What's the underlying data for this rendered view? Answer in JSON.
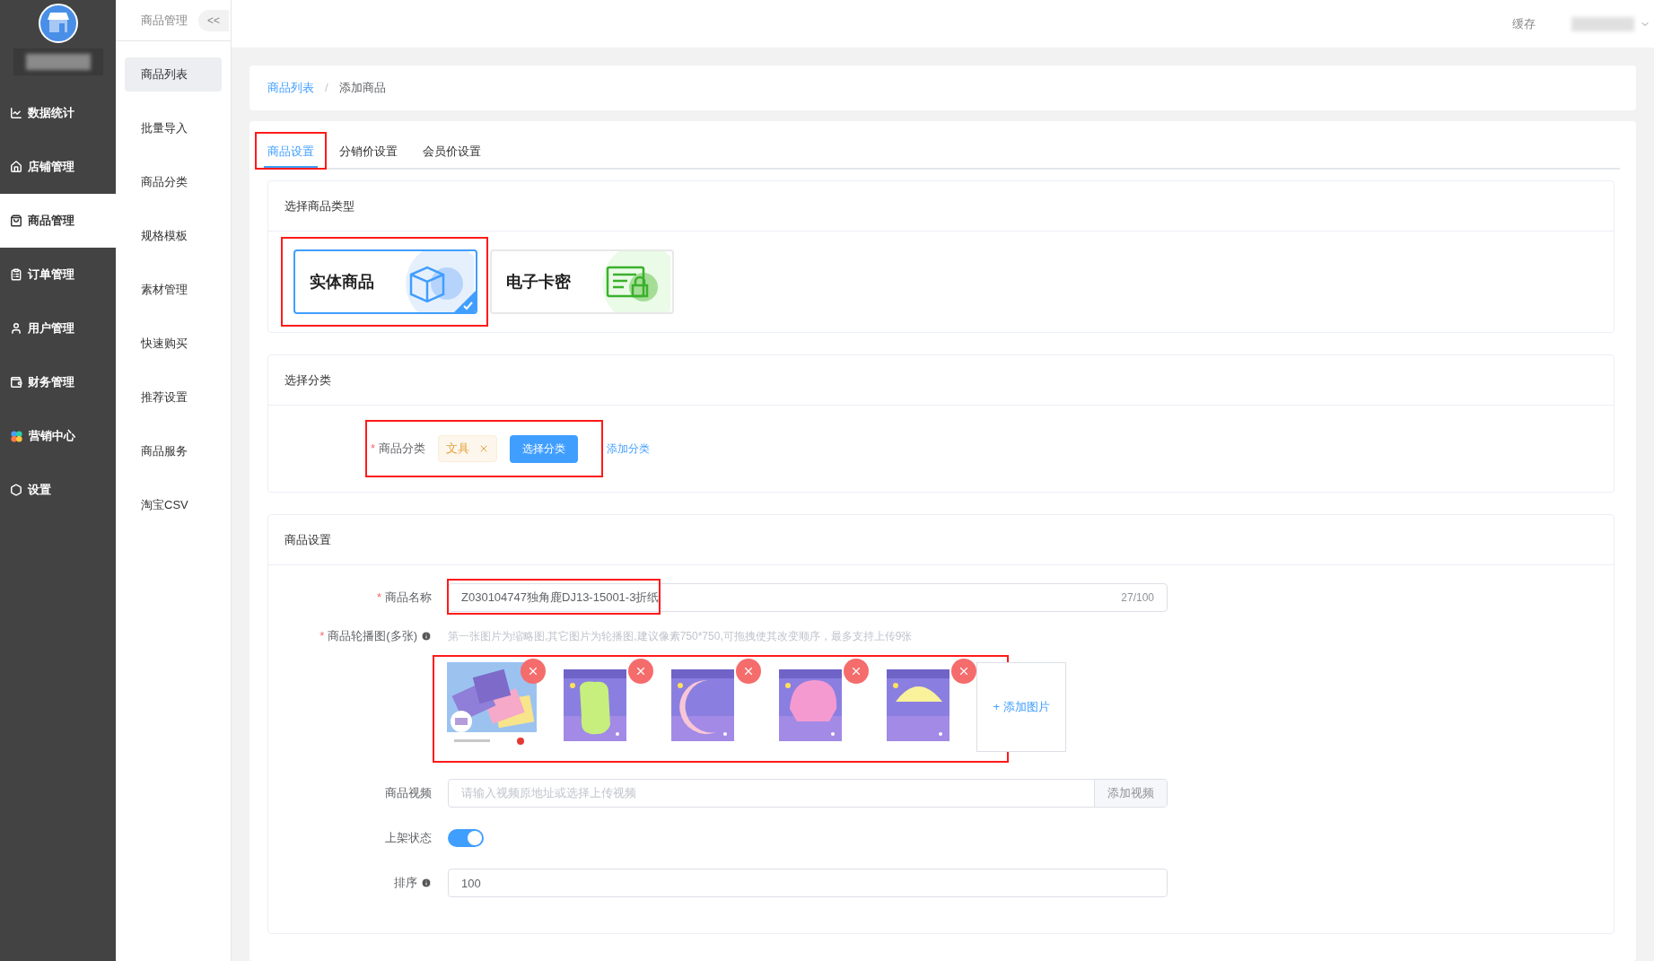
{
  "sidebar": {
    "items": [
      {
        "label": "数据统计",
        "selected": false
      },
      {
        "label": "店铺管理",
        "selected": false
      },
      {
        "label": "商品管理",
        "selected": true
      },
      {
        "label": "订单管理",
        "selected": false
      },
      {
        "label": "用户管理",
        "selected": false
      },
      {
        "label": "财务管理",
        "selected": false
      },
      {
        "label": "营销中心",
        "selected": false
      },
      {
        "label": "设置",
        "selected": false
      }
    ]
  },
  "submenu": {
    "title": "商品管理",
    "collapse": "<<",
    "items": [
      {
        "label": "商品列表",
        "selected": true
      },
      {
        "label": "批量导入",
        "selected": false
      },
      {
        "label": "商品分类",
        "selected": false
      },
      {
        "label": "规格模板",
        "selected": false
      },
      {
        "label": "素材管理",
        "selected": false
      },
      {
        "label": "快速购买",
        "selected": false
      },
      {
        "label": "推荐设置",
        "selected": false
      },
      {
        "label": "商品服务",
        "selected": false
      },
      {
        "label": "淘宝CSV",
        "selected": false
      }
    ]
  },
  "header": {
    "cache": "缓存"
  },
  "breadcrumb": {
    "items": [
      "商品列表",
      "添加商品"
    ],
    "separator": "/"
  },
  "tabs": [
    {
      "label": "商品设置",
      "selected": true,
      "highlighted": true
    },
    {
      "label": "分销价设置",
      "selected": false
    },
    {
      "label": "会员价设置",
      "selected": false
    }
  ],
  "type_section": {
    "title": "选择商品类型",
    "types": [
      {
        "label": "实体商品",
        "kind": "physical",
        "selected": true,
        "highlighted": true
      },
      {
        "label": "电子卡密",
        "kind": "card",
        "selected": false
      }
    ]
  },
  "category_section": {
    "title": "选择分类",
    "label": "商品分类",
    "required_mark": "*",
    "highlighted": true,
    "tags": [
      "文具"
    ],
    "select_button": "选择分类",
    "add_link": "添加分类"
  },
  "product_section": {
    "title": "商品设置",
    "name": {
      "label": "商品名称",
      "required_mark": "*",
      "highlighted": true,
      "value": "Z030104747独角鹿DJ13-15001-3折纸",
      "counter": "27/100"
    },
    "carousel": {
      "label": "商品轮播图(多张)",
      "required_mark": "*",
      "highlighted": true,
      "hint": "第一张图片为缩略图,其它图片为轮播图,建议像素750*750,可拖拽使其改变顺序，最多支持上传9张",
      "add_button": "+ 添加图片"
    },
    "video": {
      "label": "商品视频",
      "placeholder": "请输入视频原地址或选择上传视频",
      "button": "添加视频"
    },
    "status": {
      "label": "上架状态",
      "on": true
    },
    "sort": {
      "label": "排序",
      "value": "100"
    }
  }
}
